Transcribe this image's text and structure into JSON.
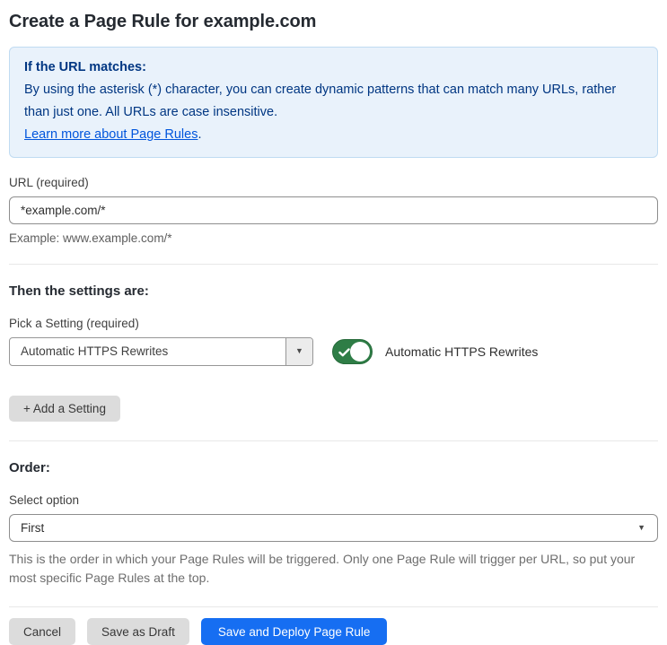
{
  "page": {
    "title": "Create a Page Rule for example.com"
  },
  "info_box": {
    "heading": "If the URL matches:",
    "body": "By using the asterisk (*) character, you can create dynamic patterns that can match many URLs, rather than just one. All URLs are case insensitive.",
    "link_label": "Learn more about Page Rules",
    "link_suffix": "."
  },
  "url_field": {
    "label": "URL (required)",
    "value": "*example.com/*",
    "hint": "Example: www.example.com/*"
  },
  "settings_section": {
    "heading": "Then the settings are:",
    "setting_label": "Pick a Setting (required)",
    "setting_value": "Automatic HTTPS Rewrites",
    "toggle": {
      "state": "on",
      "label": "Automatic HTTPS Rewrites"
    },
    "add_button_label": "+ Add a Setting"
  },
  "order_section": {
    "heading": "Order:",
    "select_label": "Select option",
    "select_value": "First",
    "help": "This is the order in which your Page Rules will be triggered. Only one Page Rule will trigger per URL, so put your most specific Page Rules at the top."
  },
  "footer": {
    "cancel_label": "Cancel",
    "save_draft_label": "Save as Draft",
    "save_deploy_label": "Save and Deploy Page Rule"
  },
  "icons": {
    "caret_down": "▼"
  },
  "colors": {
    "info_background": "#e9f2fb",
    "info_border": "#c0dbf2",
    "info_text": "#003682",
    "link_blue": "#0055dc",
    "toggle_green": "#2e7d46",
    "primary_button_blue": "#166ef2",
    "gray_button": "#dcdcdc"
  }
}
